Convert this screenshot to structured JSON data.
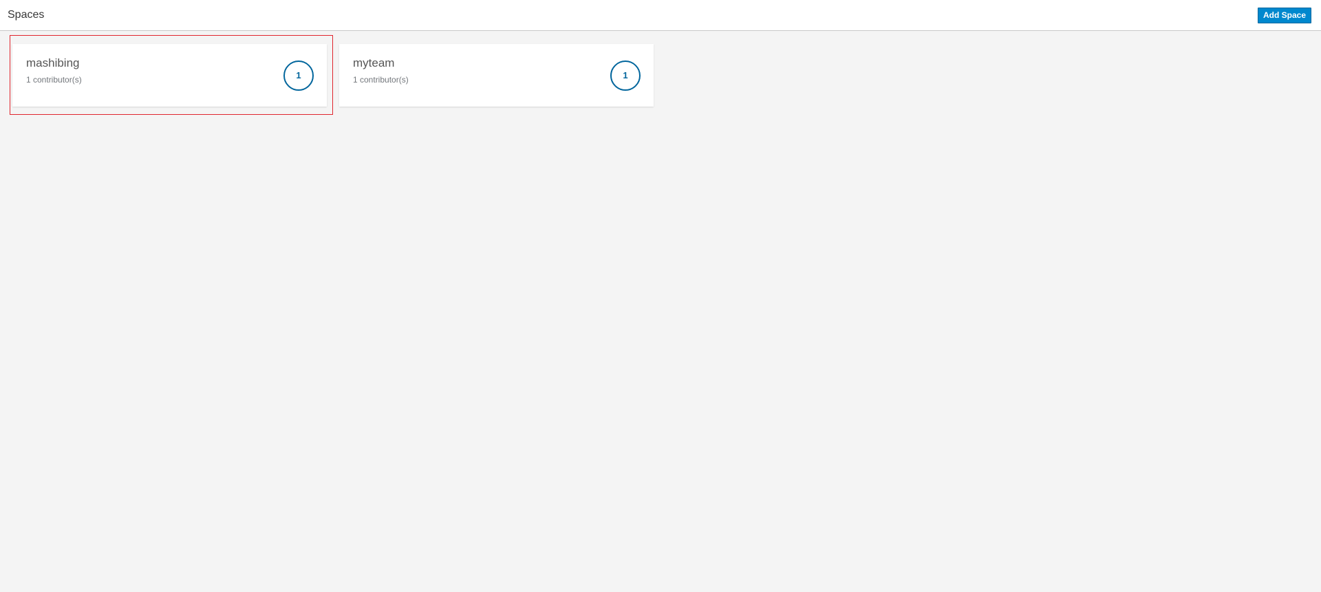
{
  "header": {
    "title": "Spaces",
    "add_button_label": "Add Space"
  },
  "spaces": [
    {
      "name": "mashibing",
      "contributors_label": "1 contributor(s)",
      "count": "1"
    },
    {
      "name": "myteam",
      "contributors_label": "1 contributor(s)",
      "count": "1"
    }
  ],
  "colors": {
    "accent": "#0088ce",
    "circle": "#00659c",
    "highlight": "#e0242c",
    "background": "#f4f4f4"
  }
}
